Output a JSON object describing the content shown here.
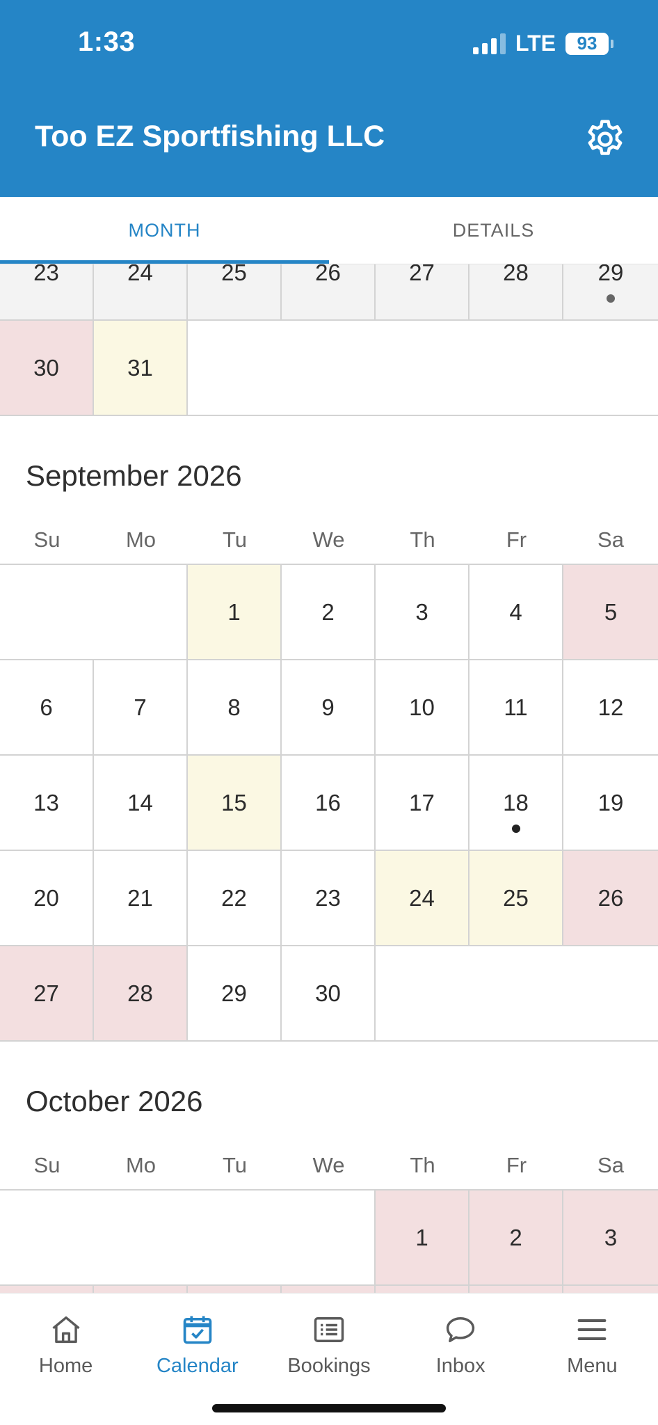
{
  "status": {
    "time": "1:33",
    "network": "LTE",
    "battery": "93"
  },
  "header": {
    "title": "Too EZ Sportfishing LLC"
  },
  "tabs": [
    {
      "label": "MONTH"
    },
    {
      "label": "DETAILS"
    }
  ],
  "weekdays": [
    "Su",
    "Mo",
    "Tu",
    "We",
    "Th",
    "Fr",
    "Sa"
  ],
  "august": {
    "rows": [
      [
        "23",
        "24",
        "25",
        "26",
        "27",
        "28",
        "29"
      ],
      [
        "30",
        "31",
        "",
        "",
        "",
        "",
        ""
      ]
    ]
  },
  "september": {
    "title": "September 2026",
    "rows": [
      [
        "",
        "",
        "1",
        "2",
        "3",
        "4",
        "5"
      ],
      [
        "6",
        "7",
        "8",
        "9",
        "10",
        "11",
        "12"
      ],
      [
        "13",
        "14",
        "15",
        "16",
        "17",
        "18",
        "19"
      ],
      [
        "20",
        "21",
        "22",
        "23",
        "24",
        "25",
        "26"
      ],
      [
        "27",
        "28",
        "29",
        "30",
        "",
        "",
        ""
      ]
    ]
  },
  "october": {
    "title": "October 2026",
    "rows": [
      [
        "",
        "",
        "",
        "",
        "1",
        "2",
        "3"
      ],
      [
        "",
        "",
        "",
        "",
        "",
        "",
        ""
      ]
    ]
  },
  "colors": {
    "brand": "#2585c6",
    "yellow": "#fbf8e3",
    "pink": "#f3dfe0",
    "grey": "#f3f3f3"
  },
  "nav": [
    {
      "label": "Home",
      "icon": "home-icon"
    },
    {
      "label": "Calendar",
      "icon": "calendar-check-icon"
    },
    {
      "label": "Bookings",
      "icon": "list-icon"
    },
    {
      "label": "Inbox",
      "icon": "chat-bubble-icon"
    },
    {
      "label": "Menu",
      "icon": "hamburger-icon"
    }
  ]
}
